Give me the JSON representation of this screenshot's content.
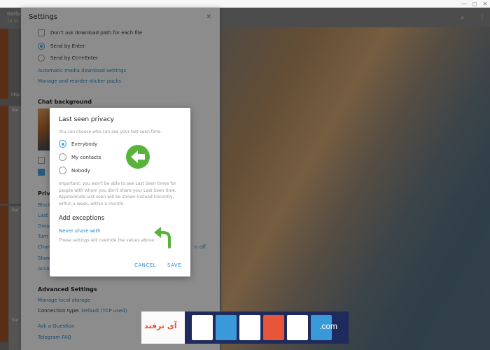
{
  "window": {
    "minimize": "—",
    "maximize": "▢",
    "close": "✕"
  },
  "chat_list": {
    "header_name": "Itarfa",
    "header_sub": "18 m",
    "link": "http",
    "cards": [
      "Itar",
      "Itar",
      "Itar"
    ]
  },
  "header_icons": {
    "search": "⌕",
    "more": "⋮"
  },
  "settings": {
    "title": "Settings",
    "close": "✕",
    "dont_ask_path": "Don't ask download path for each file",
    "send_by_enter": "Send by Enter",
    "send_by_ctrl_enter": "Send by Ctrl+Enter",
    "auto_media": "Automatic media download settings",
    "manage_stickers": "Manage and reorder sticker packs",
    "chat_background": "Chat background",
    "privacy_section": "Priva",
    "privacy_items": [
      "Block",
      "Last",
      "Grou",
      "Turn",
      "Chan",
      "Show",
      "Acco"
    ],
    "privacy_side_text": "n off",
    "advanced_settings": "Advanced Settings",
    "manage_local_storage": "Manage local storage",
    "connection_label": "Connection type:",
    "connection_value": "Default (TCP used)",
    "ask_question": "Ask a Question",
    "telegram_faq": "Telegram FAQ"
  },
  "modal": {
    "title": "Last seen privacy",
    "description": "You can choose who can see your last seen time.",
    "options": [
      {
        "label": "Everybody",
        "selected": true
      },
      {
        "label": "My contacts",
        "selected": false
      },
      {
        "label": "Nobody",
        "selected": false
      }
    ],
    "note": "Important: you won't be able to see Last Seen times for people with whom you don't share your Last Seen time. Approximate last seen will be shown instead (recently, within a week, within a month).",
    "exceptions_title": "Add exceptions",
    "never_share": "Never share with",
    "exceptions_hint": "These settings will override the values above.",
    "cancel": "CANCEL",
    "save": "SAVE"
  },
  "watermark": {
    "persian": "آی ترفند",
    "domain": ".com"
  },
  "colors": {
    "accent": "#40a7e3",
    "link": "#2a89c9",
    "arrow_green": "#58b33b"
  }
}
